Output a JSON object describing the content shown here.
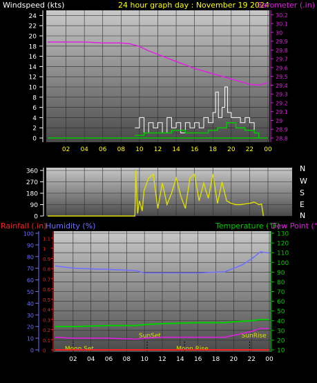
{
  "header": {
    "left_label": "Windspeed (kts)",
    "title": "24 hour graph day : November 19 2024",
    "right_label": "Barometer (.in)"
  },
  "compass": [
    "N",
    "W",
    "S",
    "E",
    "N"
  ],
  "bottom_header": {
    "rain_label": "Rainfall (.in)",
    "humidity_label": "Humidity (%)",
    "temp_label": "Temperature (°F)",
    "dew_label": "Dew Point (°F)"
  },
  "events": [
    {
      "label": "Moon Set",
      "hour": 2.0
    },
    {
      "label": "SunSet",
      "hour": 10.3
    },
    {
      "label": "Moon Rise",
      "hour": 14.5
    },
    {
      "label": "SunRise",
      "hour": 21.8
    }
  ],
  "colors": {
    "wind": "#ffffff",
    "wind_avg": "#00c800",
    "barometer": "#e020e0",
    "direction": "#e0e000",
    "humidity": "#7070ff",
    "temperature": "#00d000",
    "dewpoint": "#e020e0",
    "rain": "#ff2020"
  },
  "chart_data": [
    {
      "type": "line",
      "title": "24 hour graph day : November 19 2024",
      "xlabel": "",
      "x_ticks": [
        "02",
        "04",
        "06",
        "08",
        "10",
        "12",
        "14",
        "16",
        "18",
        "20",
        "22",
        "00"
      ],
      "xlim": [
        0,
        24
      ],
      "ylabel": "Windspeed (kts)",
      "ylim": [
        0,
        25
      ],
      "y_ticks": [
        0,
        2,
        4,
        6,
        8,
        10,
        12,
        14,
        16,
        18,
        20,
        22,
        24
      ],
      "y2label": "Barometer (.in)",
      "y2lim": [
        28.8,
        30.25
      ],
      "y2_ticks": [
        "28.8",
        "28.9",
        "29",
        "29.1",
        "29.2",
        "29.3",
        "29.4",
        "29.5",
        "29.6",
        "29.7",
        "29.8",
        "29.9",
        "30",
        "30.1",
        "30.2"
      ],
      "series": [
        {
          "key": "barometer",
          "axis": "right",
          "x": [
            0,
            2,
            4,
            6,
            8,
            9,
            10,
            11,
            12,
            13,
            14,
            15,
            16,
            17,
            18,
            19,
            20,
            21,
            22,
            23,
            24
          ],
          "values": [
            29.89,
            29.89,
            29.89,
            29.88,
            29.88,
            29.87,
            29.84,
            29.79,
            29.75,
            29.71,
            29.67,
            29.63,
            29.59,
            29.56,
            29.53,
            29.5,
            29.47,
            29.44,
            29.41,
            29.4,
            29.43
          ]
        },
        {
          "key": "wind_gust",
          "axis": "left",
          "x": [
            9.5,
            10,
            10.5,
            11,
            11.5,
            12,
            12.5,
            13,
            13.5,
            14,
            14.5,
            15,
            15.5,
            16,
            16.5,
            17,
            17.5,
            18,
            18.3,
            18.6,
            19,
            19.3,
            19.6,
            20,
            20.5,
            21,
            21.5,
            22,
            22.5,
            23
          ],
          "values": [
            2,
            4,
            1,
            3,
            2,
            3,
            1,
            4,
            2,
            3,
            1,
            3,
            2,
            3,
            2,
            4,
            3,
            5,
            9,
            4,
            6,
            10,
            5,
            4,
            4,
            3,
            4,
            3,
            1,
            0
          ]
        },
        {
          "key": "wind_avg",
          "axis": "left",
          "x": [
            9.5,
            10.5,
            12,
            13.5,
            15,
            16.5,
            17.5,
            18.5,
            19.5,
            20.5,
            21.5,
            22.5,
            23
          ],
          "values": [
            0.5,
            1,
            1,
            1.5,
            1,
            1,
            1.5,
            2,
            3,
            2,
            1.5,
            1,
            0
          ]
        }
      ]
    },
    {
      "type": "line",
      "title": "",
      "ylabel": "",
      "xlim": [
        0,
        24
      ],
      "ylim": [
        0,
        360
      ],
      "y_ticks": [
        0,
        90,
        180,
        270,
        360
      ],
      "series": [
        {
          "key": "direction",
          "x": [
            0,
            9.5,
            9.6,
            9.8,
            10.0,
            10.3,
            10.5,
            11.0,
            11.5,
            12.0,
            12.5,
            13.0,
            13.5,
            14.0,
            14.5,
            15.0,
            15.5,
            16.0,
            16.5,
            17.0,
            17.5,
            18.0,
            18.5,
            19.0,
            19.5,
            20.0,
            20.5,
            21.0,
            21.5,
            22.0,
            22.5,
            23.0,
            23.3,
            23.5
          ],
          "values": [
            0,
            0,
            360,
            20,
            120,
            40,
            200,
            300,
            330,
            60,
            260,
            90,
            180,
            300,
            160,
            60,
            300,
            330,
            120,
            260,
            140,
            330,
            100,
            270,
            120,
            100,
            90,
            90,
            95,
            100,
            110,
            90,
            95,
            0
          ]
        }
      ]
    },
    {
      "type": "line",
      "title": "",
      "x_ticks": [
        "02",
        "04",
        "06",
        "08",
        "10",
        "12",
        "14",
        "16",
        "18",
        "20",
        "22",
        "00"
      ],
      "xlim": [
        0,
        24
      ],
      "ylabel": "Rainfall (.in)",
      "y_ticks_rain": [
        "0",
        "0.1",
        "0.2",
        "0.3",
        "0.4",
        "0.5",
        "0.6",
        "0.7",
        "0.8",
        "0.9",
        "1",
        "1.1"
      ],
      "y_ticks_humidity": [
        0,
        10,
        20,
        30,
        40,
        50,
        60,
        70,
        80,
        90,
        100
      ],
      "y2label": "Temperature (°F)",
      "y2lim": [
        10,
        130
      ],
      "y2_ticks": [
        10,
        20,
        30,
        40,
        50,
        60,
        70,
        80,
        90,
        100,
        110,
        120,
        130
      ],
      "series": [
        {
          "key": "humidity",
          "axis": "humidity",
          "ylim": [
            0,
            100
          ],
          "x": [
            0,
            2,
            6,
            9,
            10,
            12,
            16,
            19,
            20,
            21,
            22,
            23,
            24
          ],
          "values": [
            72,
            70,
            69,
            68,
            66,
            66,
            66,
            67,
            70,
            73,
            78,
            84,
            83
          ]
        },
        {
          "key": "temperature",
          "axis": "right",
          "x": [
            0,
            2,
            6,
            9,
            10,
            12,
            16,
            19,
            20,
            22,
            23,
            24
          ],
          "values": [
            34,
            34,
            35,
            35,
            36,
            37,
            38,
            38,
            39,
            40,
            41,
            41
          ]
        },
        {
          "key": "dewpoint",
          "axis": "right",
          "x": [
            0,
            2,
            6,
            9,
            10,
            12,
            16,
            19,
            20,
            21,
            22,
            23,
            24
          ],
          "values": [
            23,
            22,
            22,
            21,
            22,
            23,
            23,
            23,
            25,
            27,
            29,
            32,
            32
          ]
        },
        {
          "key": "rain",
          "axis": "rain",
          "x": [
            0,
            24
          ],
          "values": [
            0,
            0
          ]
        }
      ]
    }
  ]
}
